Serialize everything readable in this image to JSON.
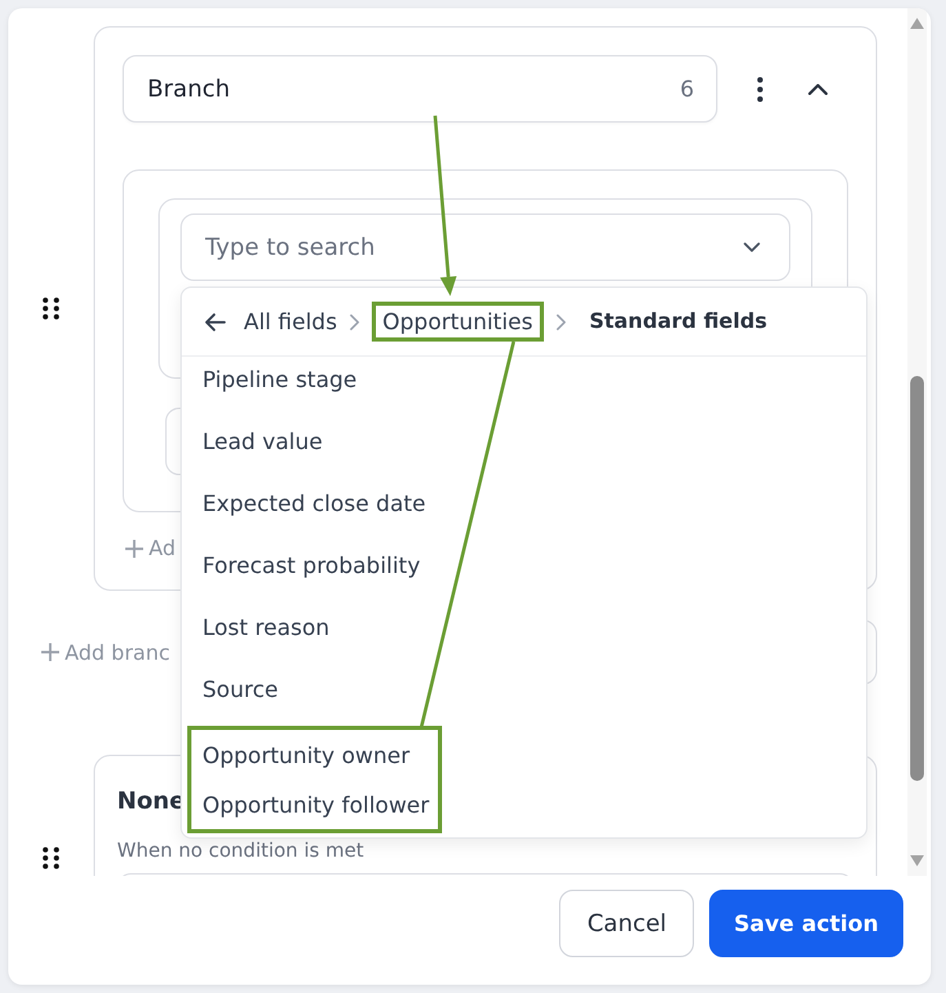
{
  "branch_card": {
    "expanded": true,
    "name_field": {
      "value": "Branch",
      "count": "6"
    },
    "search": {
      "placeholder": "Type to search"
    },
    "add_condition": {
      "label": "Ad"
    }
  },
  "add_branch": {
    "label": "Add branc"
  },
  "fallback_branch": {
    "title": "None",
    "subtitle": "When no condition is met"
  },
  "field_picker": {
    "breadcrumb": [
      {
        "label": "All fields",
        "current": false,
        "highlighted": false
      },
      {
        "label": "Opportunities",
        "current": false,
        "highlighted": true
      },
      {
        "label": "Standard fields",
        "current": true,
        "highlighted": false
      }
    ],
    "fields": [
      {
        "label": "Pipeline stage",
        "highlighted": false
      },
      {
        "label": "Lead value",
        "highlighted": false
      },
      {
        "label": "Expected close date",
        "highlighted": false
      },
      {
        "label": "Forecast probability",
        "highlighted": false
      },
      {
        "label": "Lost reason",
        "highlighted": false
      },
      {
        "label": "Source",
        "highlighted": false
      },
      {
        "label": "Opportunity owner",
        "highlighted": true
      },
      {
        "label": "Opportunity follower",
        "highlighted": true
      }
    ]
  },
  "footer": {
    "buttons": [
      {
        "label": "Cancel",
        "kind": "secondary"
      },
      {
        "label": "Save action",
        "kind": "primary"
      }
    ]
  }
}
